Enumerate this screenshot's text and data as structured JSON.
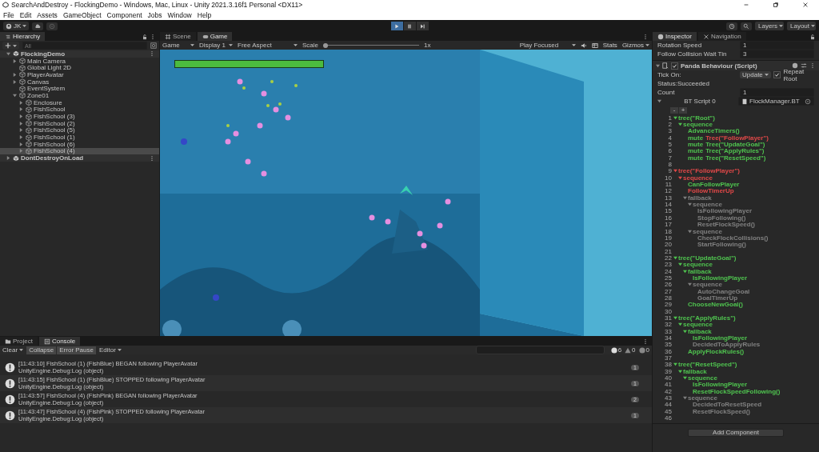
{
  "window": {
    "title": "SearchAndDestroy - FlockingDemo - Windows, Mac, Linux - Unity 2021.3.16f1 Personal <DX11>"
  },
  "menu": [
    "File",
    "Edit",
    "Assets",
    "GameObject",
    "Component",
    "Jobs",
    "Window",
    "Help"
  ],
  "toolbar": {
    "account": "JK",
    "play_controls": [
      {
        "kind": "play",
        "selected": true
      },
      {
        "kind": "pause",
        "selected": false
      },
      {
        "kind": "step",
        "selected": false
      }
    ],
    "layers": "Layers",
    "layout": "Layout"
  },
  "hierarchy": {
    "title": "Hierarchy",
    "search_placeholder": "All",
    "items": [
      {
        "label": "FlockingDemo",
        "kind": "scene",
        "expanded": true,
        "selected": false,
        "children": [
          {
            "label": "Main Camera",
            "kind": "object",
            "expanded": false,
            "selected": false
          },
          {
            "label": "Global Light 2D",
            "kind": "object",
            "selected": false
          },
          {
            "label": "PlayerAvatar",
            "kind": "object",
            "expanded": false,
            "selected": false
          },
          {
            "label": "Canvas",
            "kind": "object",
            "expanded": false,
            "selected": false
          },
          {
            "label": "EventSystem",
            "kind": "object",
            "selected": false
          },
          {
            "label": "Zone01",
            "kind": "object",
            "expanded": true,
            "selected": false,
            "children": [
              {
                "label": "Enclosure",
                "kind": "object",
                "expanded": false,
                "selected": false
              },
              {
                "label": "FishSchool",
                "kind": "object",
                "expanded": false,
                "selected": false
              },
              {
                "label": "FishSchool (3)",
                "kind": "object",
                "expanded": false,
                "selected": false
              },
              {
                "label": "FishSchool (2)",
                "kind": "object",
                "expanded": false,
                "selected": false
              },
              {
                "label": "FishSchool (5)",
                "kind": "object",
                "expanded": false,
                "selected": false
              },
              {
                "label": "FishSchool (1)",
                "kind": "object",
                "expanded": false,
                "selected": false
              },
              {
                "label": "FishSchool (6)",
                "kind": "object",
                "expanded": false,
                "selected": false
              },
              {
                "label": "FishSchool (4)",
                "kind": "object",
                "expanded": false,
                "selected": true
              }
            ]
          }
        ]
      },
      {
        "label": "DontDestroyOnLoad",
        "kind": "scene",
        "expanded": false,
        "selected": false
      }
    ]
  },
  "game_view": {
    "tabs": [
      {
        "label": "Scene",
        "kind": "scene",
        "selected": false
      },
      {
        "label": "Game",
        "kind": "game",
        "selected": true
      }
    ],
    "dropdowns": [
      "Game",
      "Display 1",
      "Free Aspect"
    ],
    "scale_label": "Scale",
    "scale": {
      "level": 0
    },
    "scale_reading": "1x",
    "play_mode": "Play Focused",
    "stats": "Stats",
    "gizmos": "Gizmos",
    "health_bar": {
      "level": 1
    }
  },
  "console": {
    "tabs": [
      {
        "label": "Project",
        "kind": "project",
        "selected": false
      },
      {
        "label": "Console",
        "kind": "console",
        "selected": true
      }
    ],
    "buttons": [
      {
        "label": "Clear",
        "dropdown": true,
        "on": false
      },
      {
        "label": "Collapse",
        "dropdown": false,
        "on": true
      },
      {
        "label": "Error Pause",
        "dropdown": false,
        "on": true
      },
      {
        "label": "Editor",
        "dropdown": true,
        "on": false
      }
    ],
    "counts": [
      {
        "kind": "info",
        "count": "6"
      },
      {
        "kind": "warning",
        "count": "0"
      },
      {
        "kind": "error",
        "count": "0"
      }
    ],
    "entries": [
      {
        "message": "[11:43:10] FishSchool (1) (FishBlue) BEGAN following PlayerAvatar",
        "detail": "UnityEngine.Debug:Log (object)",
        "count": "1"
      },
      {
        "message": "[11:43:15] FishSchool (1) (FishBlue) STOPPED following PlayerAvatar",
        "detail": "UnityEngine.Debug:Log (object)",
        "count": "1"
      },
      {
        "message": "[11:43:57] FishSchool (4) (FishPink) BEGAN following PlayerAvatar",
        "detail": "UnityEngine.Debug:Log (object)",
        "count": "2"
      },
      {
        "message": "[11:43:47] FishSchool (4) (FishPink) STOPPED following PlayerAvatar",
        "detail": "UnityEngine.Debug:Log (object)",
        "count": "1"
      }
    ]
  },
  "inspector": {
    "tabs": [
      {
        "label": "Inspector",
        "kind": "info",
        "selected": true
      },
      {
        "label": "Navigation",
        "kind": "navigation",
        "selected": false
      }
    ],
    "fields": [
      {
        "label": "Rotation Speed",
        "value": "1"
      },
      {
        "label": "Follow Collision Wait Tin",
        "value": "3"
      }
    ],
    "component": {
      "title": "Panda Behaviour (Script)",
      "enabled": true,
      "tick_on_label": "Tick On:",
      "tick_on": "Update",
      "repeat_root": {
        "label": "Repeat Root",
        "checked": true
      },
      "status": "Status:Succeeded",
      "count_label": "Count",
      "count": "1",
      "script_label": "BT Script 0",
      "script": "FlockManager.BT",
      "minus": "-",
      "plus": "+"
    },
    "code": [
      {
        "line": "1",
        "text": "tree(\"Root\")",
        "color": "#4fc34f",
        "children": [
          {
            "line": "2",
            "text": "sequence",
            "color": "#4fc34f",
            "children": [
              {
                "line": "3",
                "text": "AdvanceTimers()",
                "color": "#4fc34f"
              },
              {
                "line": "4",
                "segments": [
                  {
                    "text": "mute",
                    "color": "#4fc34f"
                  },
                  {
                    "text": "Tree(\"FollowPlayer\")",
                    "color": "#e04848"
                  }
                ]
              },
              {
                "line": "5",
                "segments": [
                  {
                    "text": "mute",
                    "color": "#4fc34f"
                  },
                  {
                    "text": "Tree(\"UpdateGoal\")",
                    "color": "#4fc34f"
                  }
                ]
              },
              {
                "line": "6",
                "segments": [
                  {
                    "text": "mute",
                    "color": "#4fc34f"
                  },
                  {
                    "text": "Tree(\"ApplyRules\")",
                    "color": "#4fc34f"
                  }
                ]
              },
              {
                "line": "7",
                "segments": [
                  {
                    "text": "mute",
                    "color": "#4fc34f"
                  },
                  {
                    "text": "Tree(\"ResetSpeed\")",
                    "color": "#4fc34f"
                  }
                ]
              }
            ]
          }
        ]
      },
      {
        "line": "8"
      },
      {
        "line": "9",
        "text": "tree(\"FollowPlayer\")",
        "color": "#e04848",
        "children": [
          {
            "line": "10",
            "text": "sequence",
            "color": "#e04848",
            "children": [
              {
                "line": "11",
                "text": "CanFollowPlayer",
                "color": "#4fc34f"
              },
              {
                "line": "12",
                "text": "FollowTimerUp",
                "color": "#e04848"
              },
              {
                "line": "13",
                "text": "fallback",
                "color": "#808080",
                "children": [
                  {
                    "line": "14",
                    "text": "sequence",
                    "color": "#808080",
                    "children": [
                      {
                        "line": "15",
                        "text": "IsFollowingPlayer",
                        "color": "#808080"
                      },
                      {
                        "line": "16",
                        "text": "StopFollowing()",
                        "color": "#808080"
                      },
                      {
                        "line": "17",
                        "text": "ResetFlockSpeed()",
                        "color": "#808080"
                      }
                    ]
                  },
                  {
                    "line": "18",
                    "text": "sequence",
                    "color": "#808080",
                    "children": [
                      {
                        "line": "19",
                        "text": "CheckFlockCollisions()",
                        "color": "#808080"
                      },
                      {
                        "line": "20",
                        "text": "StartFollowing()",
                        "color": "#808080"
                      }
                    ]
                  }
                ]
              }
            ]
          }
        ]
      },
      {
        "line": "21"
      },
      {
        "line": "22",
        "text": "tree(\"UpdateGoal\")",
        "color": "#4fc34f",
        "children": [
          {
            "line": "23",
            "text": "sequence",
            "color": "#4fc34f",
            "children": [
              {
                "line": "24",
                "text": "fallback",
                "color": "#4fc34f",
                "children": [
                  {
                    "line": "25",
                    "text": "IsFollowingPlayer",
                    "color": "#4fc34f"
                  },
                  {
                    "line": "26",
                    "text": "sequence",
                    "color": "#808080",
                    "children": [
                      {
                        "line": "27",
                        "text": "AutoChangeGoal",
                        "color": "#808080"
                      },
                      {
                        "line": "28",
                        "text": "GoalTimerUp",
                        "color": "#808080"
                      }
                    ]
                  }
                ]
              },
              {
                "line": "29",
                "text": "ChooseNewGoal()",
                "color": "#4fc34f"
              }
            ]
          }
        ]
      },
      {
        "line": "30"
      },
      {
        "line": "31",
        "text": "tree(\"ApplyRules\")",
        "color": "#4fc34f",
        "children": [
          {
            "line": "32",
            "text": "sequence",
            "color": "#4fc34f",
            "children": [
              {
                "line": "33",
                "text": "fallback",
                "color": "#4fc34f",
                "children": [
                  {
                    "line": "34",
                    "text": "IsFollowingPlayer",
                    "color": "#4fc34f"
                  },
                  {
                    "line": "35",
                    "text": "DecidedToApplyRules",
                    "color": "#808080"
                  }
                ]
              },
              {
                "line": "36",
                "text": "ApplyFlockRules()",
                "color": "#4fc34f"
              }
            ]
          }
        ]
      },
      {
        "line": "37"
      },
      {
        "line": "38",
        "text": "tree(\"ResetSpeed\")",
        "color": "#4fc34f",
        "children": [
          {
            "line": "39",
            "text": "fallback",
            "color": "#4fc34f",
            "children": [
              {
                "line": "40",
                "text": "sequence",
                "color": "#4fc34f",
                "children": [
                  {
                    "line": "41",
                    "text": "IsFollowingPlayer",
                    "color": "#4fc34f"
                  },
                  {
                    "line": "42",
                    "text": "ResetFlockSpeedFollowing()",
                    "color": "#4fc34f"
                  }
                ]
              },
              {
                "line": "43",
                "text": "sequence",
                "color": "#808080",
                "children": [
                  {
                    "line": "44",
                    "text": "DecidedToResetSpeed",
                    "color": "#808080"
                  },
                  {
                    "line": "45",
                    "text": "ResetFlockSpeed()",
                    "color": "#808080"
                  }
                ]
              }
            ]
          }
        ]
      },
      {
        "line": "46"
      }
    ],
    "add_component": "Add Component"
  }
}
